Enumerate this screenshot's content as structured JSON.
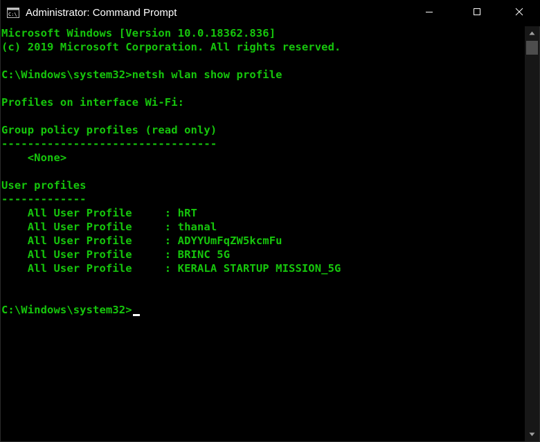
{
  "window": {
    "title": "Administrator: Command Prompt",
    "icon": "cmd-icon",
    "controls": {
      "minimize_icon": "minimize-icon",
      "maximize_icon": "maximize-icon",
      "close_icon": "close-icon"
    }
  },
  "colors": {
    "background": "#000000",
    "text": "#16c60c",
    "title_text": "#ffffff",
    "scrollbar_track": "#171717",
    "scrollbar_thumb": "#4d4d4d"
  },
  "console": {
    "header": {
      "version": "Microsoft Windows [Version 10.0.18362.836]",
      "copyright": "(c) 2019 Microsoft Corporation. All rights reserved."
    },
    "command": {
      "prompt": "C:\\Windows\\system32>",
      "text": "netsh wlan show profile"
    },
    "interface_heading": "Profiles on interface Wi-Fi:",
    "group_policy": {
      "heading": "Group policy profiles (read only)",
      "underline": "---------------------------------",
      "value": "    <None>"
    },
    "user_profiles": {
      "heading": "User profiles",
      "underline": "-------------",
      "rows": [
        {
          "label": "    All User Profile     : ",
          "value": "hRT"
        },
        {
          "label": "    All User Profile     : ",
          "value": "thanal"
        },
        {
          "label": "    All User Profile     : ",
          "value": "ADYYUmFqZW5kcmFu"
        },
        {
          "label": "    All User Profile     : ",
          "value": "BRINC 5G"
        },
        {
          "label": "    All User Profile     : ",
          "value": "KERALA STARTUP MISSION_5G"
        }
      ]
    },
    "current_prompt": "C:\\Windows\\system32>"
  },
  "scrollbar": {
    "up_icon": "scroll-up-arrow-icon",
    "down_icon": "scroll-down-arrow-icon"
  }
}
